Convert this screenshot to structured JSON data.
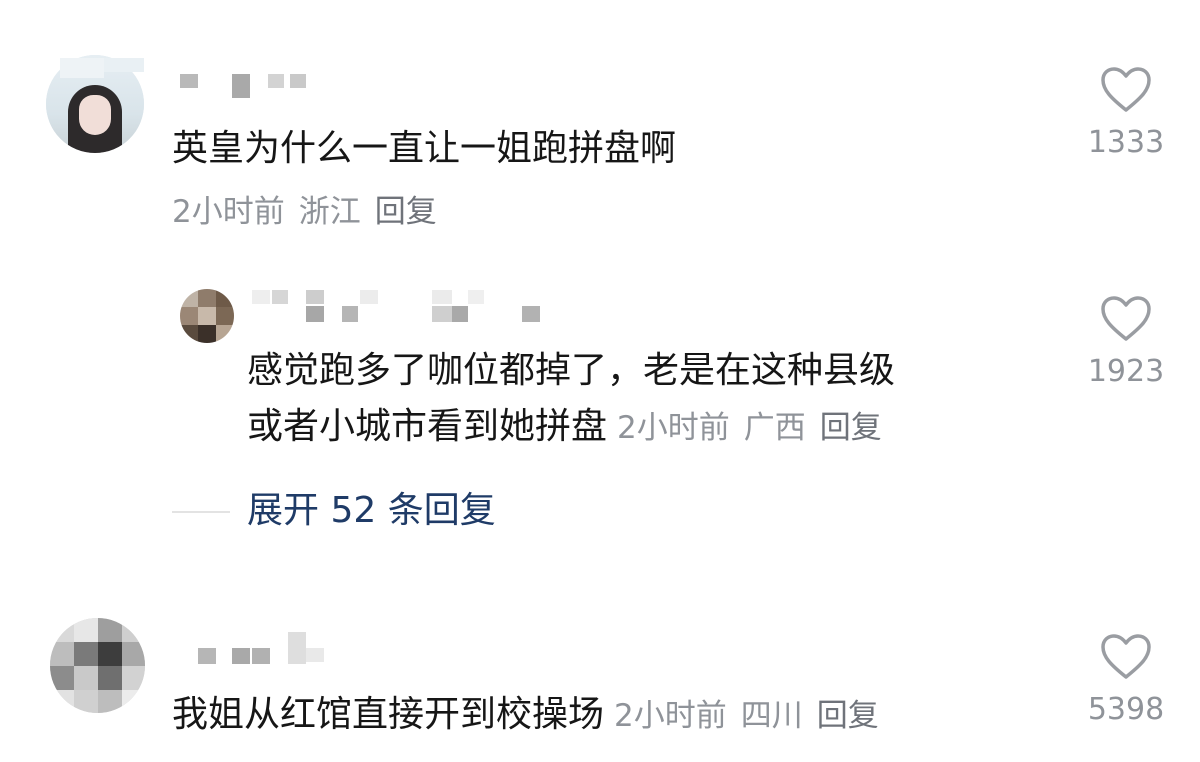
{
  "comments": [
    {
      "text": "英皇为什么一直让一姐跑拼盘啊",
      "time": "2小时前",
      "location": "浙江",
      "reply_label": "回复",
      "likes": "1333",
      "avatar_icon": "avatar-image"
    },
    {
      "text_line1": "感觉跑多了咖位都掉了，老是在这种县级",
      "text_line2": "或者小城市看到她拼盘",
      "time": "2小时前",
      "location": "广西",
      "reply_label": "回复",
      "likes": "1923",
      "avatar_icon": "avatar-image"
    },
    {
      "text": "我姐从红馆直接开到校操场",
      "time": "2小时前",
      "location": "四川",
      "reply_label": "回复",
      "likes": "5398",
      "avatar_icon": "avatar-image"
    }
  ],
  "expand_replies": "展开 52 条回复",
  "like_icon": "heart-outline-icon",
  "colors": {
    "text": "#161616",
    "meta": "#8f9399",
    "link": "#1f3b67",
    "background": "#ffffff"
  }
}
